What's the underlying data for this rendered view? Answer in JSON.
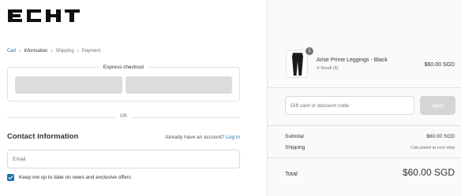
{
  "brand": {
    "logo_text": "ECHT"
  },
  "breadcrumb": {
    "items": [
      {
        "label": "Cart",
        "state": "link"
      },
      {
        "label": "Information",
        "state": "current"
      },
      {
        "label": "Shipping",
        "state": "upcoming"
      },
      {
        "label": "Payment",
        "state": "upcoming"
      }
    ],
    "separator_icon": "chevron-right-icon"
  },
  "express_checkout": {
    "title": "Express checkout",
    "buttons": [
      {
        "name": "express-pay-button-1"
      },
      {
        "name": "express-pay-button-2"
      }
    ]
  },
  "divider_text": "OR",
  "contact": {
    "heading": "Contact information",
    "account_prompt": "Already have an account?",
    "login_label": "Log in",
    "email_placeholder": "Email",
    "email_value": "",
    "newsletter_label": "Keep me up to date on news and exclusive offers",
    "newsletter_checked": true
  },
  "order_summary": {
    "product": {
      "quantity": "1",
      "name": "Arise Prime Leggings - Black",
      "variant": "X-Small (6)",
      "price": "$60.00 SGD"
    },
    "discount": {
      "placeholder": "Gift card or discount code",
      "apply_label": "Apply"
    },
    "subtotal_label": "Subtotal",
    "subtotal_value": "$60.00 SGD",
    "shipping_label": "Shipping",
    "shipping_value": "Calculated at next step",
    "total_label": "Total",
    "total_value": "$60.00 SGD"
  },
  "colors": {
    "accent": "#1773b0",
    "sidebar_bg": "#fafafa",
    "border": "#e1e1e1",
    "button_disabled": "#d5d5d5"
  }
}
